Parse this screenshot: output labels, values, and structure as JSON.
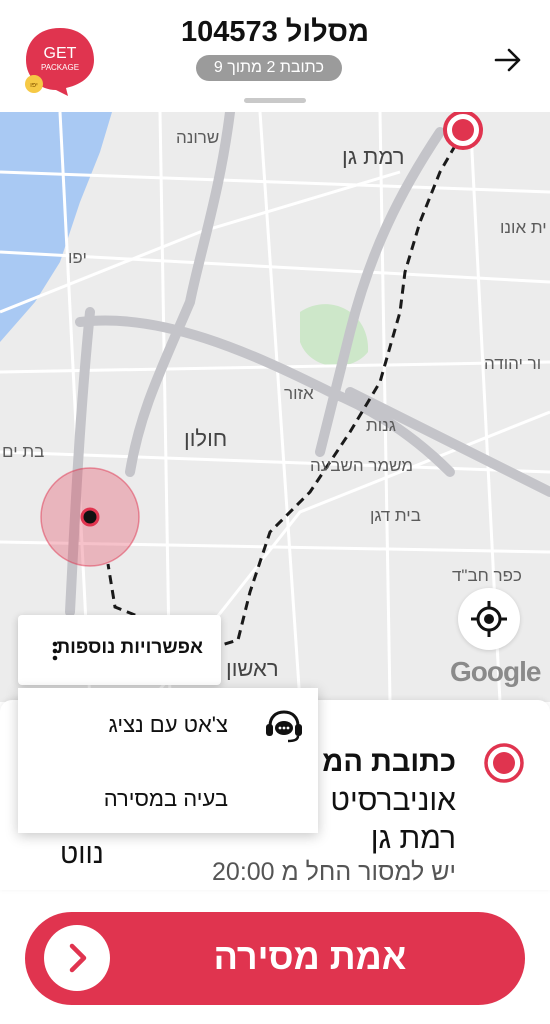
{
  "header": {
    "title": "מסלול 104573",
    "subtitle": "כתובת 2 מתוך 9",
    "logo_line1": "GET",
    "logo_line2": "PACKAGE",
    "logo_badge": "יפו",
    "back_icon": "arrow-right-icon"
  },
  "map": {
    "labels": [
      "שרונה",
      "רמת גן",
      "ית אונו",
      "יפו",
      "ור יהודה",
      "אזור",
      "גנות",
      "חולון",
      "בת ים",
      "משמר השבעה",
      "בית דגן",
      "כפר חב\"ד",
      "ראשון"
    ],
    "google_logo": "Google",
    "locate_icon": "crosshair-icon"
  },
  "more_options": {
    "label": "אפשרויות נוספות",
    "icon": "more-vertical-icon"
  },
  "menu": {
    "chat_label": "צ'אט עם נציג",
    "chat_icon": "support-chat-icon",
    "problem_label": "בעיה במסירה"
  },
  "stop": {
    "title": "כתובת המ",
    "line1": "אוניברסיט",
    "line2": "רמת גן",
    "note": "יש למסור החל מ 20:00",
    "side_text": "נווט"
  },
  "confirm": {
    "label": "אמת מסירה",
    "icon": "chevron-right-icon"
  },
  "colors": {
    "brand": "#e0344f",
    "route": "#222222",
    "map_bg": "#ececec",
    "water": "#a9c9f3"
  }
}
